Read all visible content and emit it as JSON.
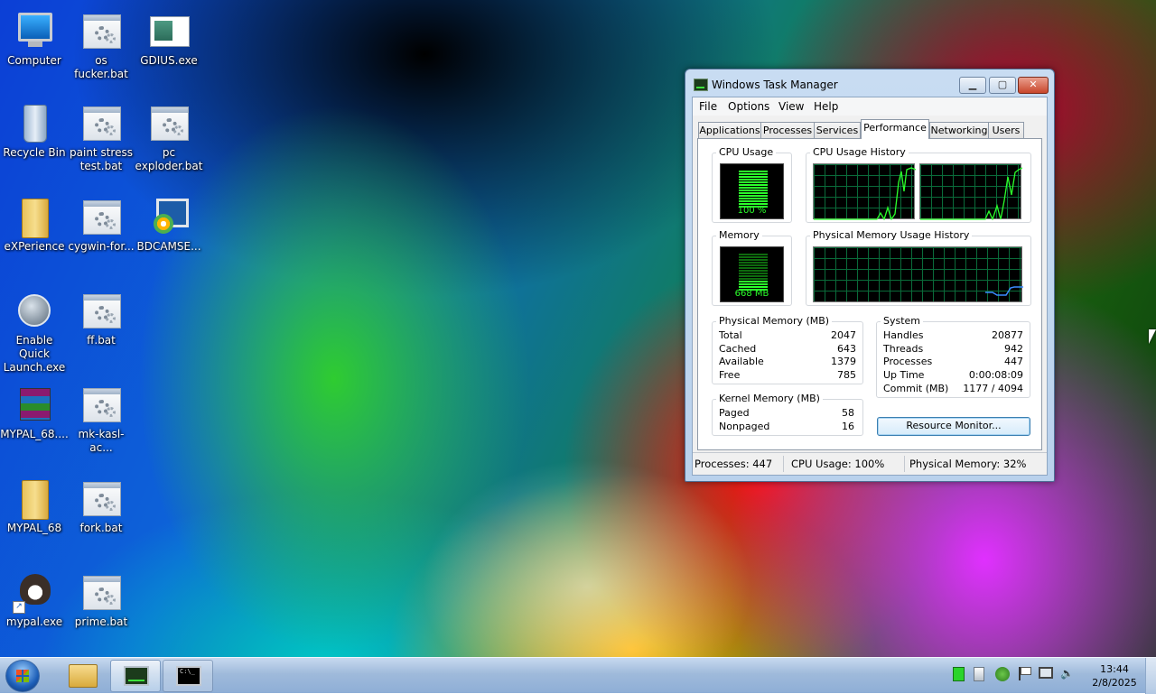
{
  "desktop": {
    "icons": [
      {
        "label": "Computer",
        "icon": "computer-icon"
      },
      {
        "label": "os fucker.bat",
        "icon": "batch-file-icon"
      },
      {
        "label": "GDIUS.exe",
        "icon": "exe-file-icon"
      },
      {
        "label": "Recycle Bin",
        "icon": "recycle-bin-icon"
      },
      {
        "label": "paint stress test.bat",
        "icon": "batch-file-icon"
      },
      {
        "label": "pc exploder.bat",
        "icon": "batch-file-icon"
      },
      {
        "label": "eXPerience",
        "icon": "folder-icon"
      },
      {
        "label": "cygwin-for...",
        "icon": "batch-file-icon"
      },
      {
        "label": "BDCAMSE...",
        "icon": "bandicam-setup-icon"
      },
      {
        "label": "Enable Quick Launch.exe",
        "icon": "quick-launch-icon"
      },
      {
        "label": "ff.bat",
        "icon": "batch-file-icon"
      },
      {
        "label": "MYPAL_68....",
        "icon": "winrar-archive-icon"
      },
      {
        "label": "mk-kasl-ac...",
        "icon": "batch-file-icon"
      },
      {
        "label": "MYPAL_68",
        "icon": "folder-icon"
      },
      {
        "label": "fork.bat",
        "icon": "batch-file-icon"
      },
      {
        "label": "mypal.exe",
        "icon": "mypal-raccoon-icon"
      },
      {
        "label": "prime.bat",
        "icon": "batch-file-icon"
      }
    ]
  },
  "task_manager": {
    "title": "Windows Task Manager",
    "menu": [
      "File",
      "Options",
      "View",
      "Help"
    ],
    "tabs": [
      "Applications",
      "Processes",
      "Services",
      "Performance",
      "Networking",
      "Users"
    ],
    "active_tab": "Performance",
    "cpu_usage": {
      "label": "CPU Usage",
      "value_text": "100 %",
      "fraction": 1.0
    },
    "cpu_history": {
      "label": "CPU Usage History"
    },
    "memory": {
      "label": "Memory",
      "value_text": "668 MB",
      "fraction": 0.32
    },
    "memory_history": {
      "label": "Physical Memory Usage History"
    },
    "physical_memory": {
      "label": "Physical Memory (MB)",
      "rows": [
        {
          "k": "Total",
          "v": "2047"
        },
        {
          "k": "Cached",
          "v": "643"
        },
        {
          "k": "Available",
          "v": "1379"
        },
        {
          "k": "Free",
          "v": "785"
        }
      ]
    },
    "kernel_memory": {
      "label": "Kernel Memory (MB)",
      "rows": [
        {
          "k": "Paged",
          "v": "58"
        },
        {
          "k": "Nonpaged",
          "v": "16"
        }
      ]
    },
    "system": {
      "label": "System",
      "rows": [
        {
          "k": "Handles",
          "v": "20877"
        },
        {
          "k": "Threads",
          "v": "942"
        },
        {
          "k": "Processes",
          "v": "447"
        },
        {
          "k": "Up Time",
          "v": "0:00:08:09"
        },
        {
          "k": "Commit (MB)",
          "v": "1177 / 4094"
        }
      ]
    },
    "resource_monitor_button": "Resource Monitor...",
    "status": {
      "processes": "Processes: 447",
      "cpu": "CPU Usage: 100%",
      "memory": "Physical Memory: 32%"
    }
  },
  "taskbar": {
    "clock_time": "13:44",
    "clock_date": "2/8/2025"
  }
}
